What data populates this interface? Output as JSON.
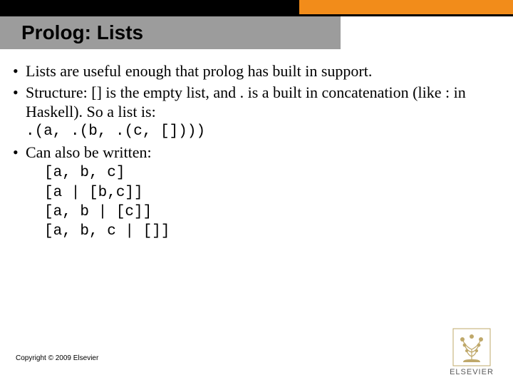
{
  "header": {
    "title": "Prolog: Lists"
  },
  "bullets": [
    {
      "text": "Lists are useful enough that prolog has built in support."
    },
    {
      "text": "Structure: [] is the empty list, and . is a built in concatenation (like : in Haskell).  So a list is:",
      "code": ".(a, .(b, .(c, [])))"
    },
    {
      "text": "Can also be written:",
      "code": "[a, b, c]\n[a | [b,c]]\n[a, b | [c]]\n[a, b, c | []]"
    }
  ],
  "footer": {
    "copyright": "Copyright © 2009 Elsevier",
    "brand": "ELSEVIER"
  },
  "colors": {
    "accent": "#f28c1a",
    "headerbar": "#9c9c9c"
  }
}
